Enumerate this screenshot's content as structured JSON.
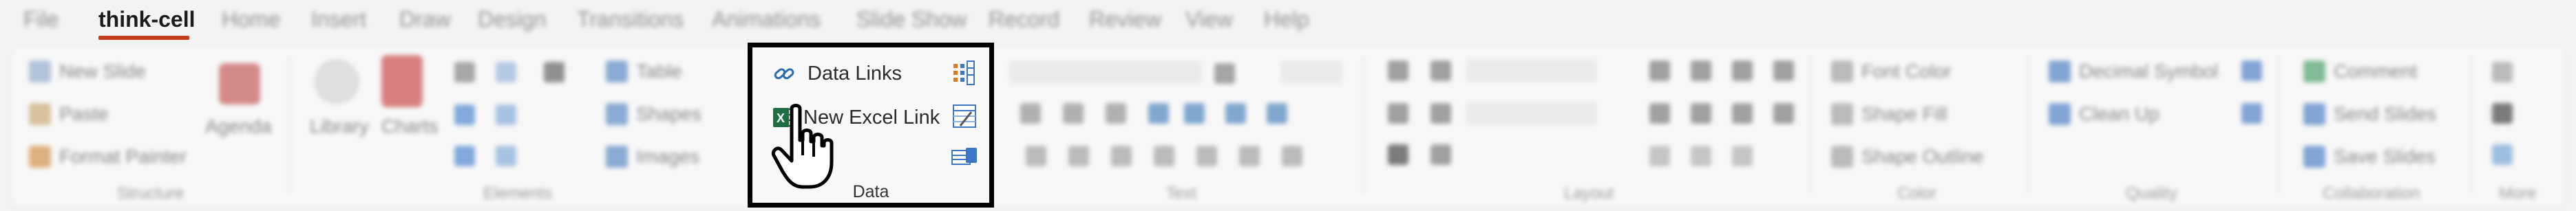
{
  "tabs": [
    "File",
    "think-cell",
    "Home",
    "Insert",
    "Draw",
    "Design",
    "Transitions",
    "Animations",
    "Slide Show",
    "Record",
    "Review",
    "View",
    "Help"
  ],
  "groups": {
    "structure": {
      "label": "Structure",
      "new_slide": "New Slide",
      "paste": "Paste",
      "format_painter": "Format Painter",
      "agenda": "Agenda"
    },
    "elements": {
      "label": "Elements",
      "library": "Library",
      "charts": "Charts",
      "table": "Table",
      "shapes": "Shapes",
      "images": "Images"
    },
    "data": {
      "label": "Data",
      "data_links": "Data Links",
      "new_excel_link": "New Excel Link"
    },
    "text": {
      "label": "Text"
    },
    "layout": {
      "label": "Layout"
    },
    "color": {
      "label": "Color",
      "font_color": "Font Color",
      "shape_fill": "Shape Fill",
      "shape_outline": "Shape Outline"
    },
    "quality": {
      "label": "Quality",
      "decimal_symbol": "Decimal Symbol",
      "clean_up": "Clean Up"
    },
    "collaboration": {
      "label": "Collaboration",
      "comment": "Comment",
      "send_slides": "Send Slides",
      "save_slides": "Save Slides"
    },
    "more": {
      "label": "More"
    }
  },
  "colors": {
    "accent_underline": "#c43e1c",
    "focus_border": "#000000",
    "excel_green": "#1d6f42",
    "link_blue": "#2b6cb0"
  },
  "icons": {
    "data_links": "link-icon",
    "new_excel_link": "excel-icon",
    "pointer": "hand-pointer-icon",
    "data_grid": "data-grid-icon",
    "data_sheet": "data-sheet-icon",
    "data_table": "data-table-icon"
  }
}
